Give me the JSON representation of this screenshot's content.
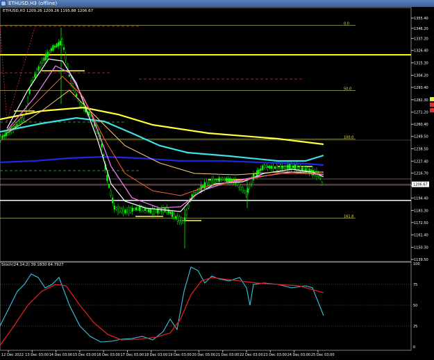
{
  "window": {
    "title": "ETHUSD,H3 (offline)",
    "icon": "chart-window-icon"
  },
  "price_panel": {
    "header": "ETHUSD,H3  1209.26 1209.26 1195.88 1206.67",
    "price_axis_labels": [
      "1355.40",
      "1346.20",
      "1337.20",
      "1326.40",
      "1315.30",
      "1304.20",
      "1293.40",
      "1282.30",
      "1271.20",
      "1260.40",
      "1249.50",
      "1238.50",
      "1227.40",
      "1216.70",
      "1205.60",
      "1194.40",
      "1183.30",
      "1172.50",
      "1161.40",
      "1150.30",
      "1139.50"
    ],
    "current_price": "1206.67",
    "fib_levels": [
      {
        "label": "0.0",
        "price": 1349
      },
      {
        "label": "50.0",
        "price": 1290.5
      },
      {
        "label": "100.0",
        "price": 1247
      },
      {
        "label": "161.8",
        "price": 1176.5
      }
    ],
    "colors": {
      "candle": "#00ff00",
      "ma_yellow": "#ffff40",
      "ma_cyan": "#40e0e8",
      "ma_blue": "#1e28e0",
      "horizontal_yellow": "#ffff00",
      "horizontal_white": "#ffffff",
      "current_price_line": "#ff3b3b"
    }
  },
  "indicator_panel": {
    "header": "Stoch(24,14,2) 39.1830 64.7927",
    "scale_labels": [
      "100",
      "75",
      "50",
      "25",
      "0"
    ],
    "colors": {
      "main": "#38c8e0",
      "signal": "#e02020"
    }
  },
  "time_axis_labels": [
    "12 Dec 2022",
    "13 Dec 03:00",
    "14 Dec 03:00",
    "15 Dec 03:00",
    "16 Dec 03:00",
    "17 Dec 03:00",
    "18 Dec 03:00",
    "19 Dec 03:00",
    "20 Dec 03:00",
    "21 Dec 03:00",
    "22 Dec 03:00",
    "23 Dec 03:00",
    "24 Dec 03:00",
    "25 Dec 03:00"
  ]
}
